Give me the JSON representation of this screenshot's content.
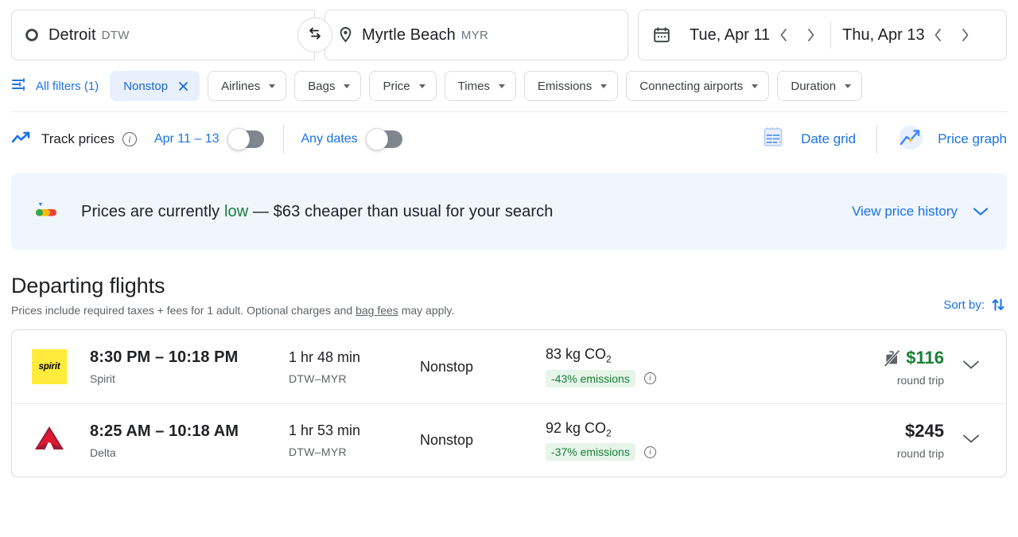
{
  "search": {
    "origin": {
      "city": "Detroit",
      "code": "DTW",
      "icon": "circle-outline-icon"
    },
    "destination": {
      "city": "Myrtle Beach",
      "code": "MYR",
      "icon": "location-pin-icon"
    },
    "swap_icon": "swap-arrows-icon",
    "calendar_icon": "calendar-icon",
    "depart_date": "Tue, Apr 11",
    "return_date": "Thu, Apr 13",
    "prev_label": "‹",
    "next_label": "›"
  },
  "filters": {
    "all_filters_label": "All filters (1)",
    "all_filters_icon": "tune-sliders-icon",
    "chips": [
      {
        "label": "Nonstop",
        "active": true,
        "close_icon": "close-icon"
      },
      {
        "label": "Airlines",
        "active": false
      },
      {
        "label": "Bags",
        "active": false
      },
      {
        "label": "Price",
        "active": false
      },
      {
        "label": "Times",
        "active": false
      },
      {
        "label": "Emissions",
        "active": false
      },
      {
        "label": "Connecting airports",
        "active": false
      },
      {
        "label": "Duration",
        "active": false
      }
    ]
  },
  "track_row": {
    "trend_icon": "trend-line-icon",
    "track_label": "Track prices",
    "info_icon": "info-icon",
    "toggles": [
      {
        "label": "Apr 11 – 13",
        "on": false
      },
      {
        "label": "Any dates",
        "on": false
      }
    ],
    "date_grid": {
      "label": "Date grid",
      "icon": "date-grid-icon"
    },
    "price_graph": {
      "label": "Price graph",
      "icon": "price-graph-icon"
    }
  },
  "banner": {
    "icon": "price-gauge-icon",
    "text_before": "Prices are currently ",
    "highlight": "low",
    "text_after": " — $63 cheaper than usual for your search",
    "link_label": "View price history",
    "chevron_icon": "chevron-down-icon",
    "bg_color": "#f0f5fe",
    "highlight_color": "#188038"
  },
  "departing": {
    "title": "Departing flights",
    "subtitle_before": "Prices include required taxes + fees for 1 adult. Optional charges and ",
    "subtitle_link": "bag fees",
    "subtitle_after": " may apply.",
    "sort_label": "Sort by:",
    "sort_icon": "sort-arrows-icon"
  },
  "flights": [
    {
      "airline_logo": "spirit-logo",
      "logo_text": "spirit",
      "times": "8:30 PM – 10:18 PM",
      "airline": "Spirit",
      "duration": "1 hr 48 min",
      "route": "DTW–MYR",
      "stops": "Nonstop",
      "emissions": "83 kg CO",
      "emissions_sub": "2",
      "emissions_badge": "-43% emissions",
      "emissions_info_icon": "info-icon",
      "bag_icon": "no-carry-on-bag-icon",
      "has_bag_icon": true,
      "price": "$116",
      "price_color": "green",
      "price_sub": "round trip",
      "expand_icon": "chevron-down-icon"
    },
    {
      "airline_logo": "delta-logo",
      "logo_text": "",
      "times": "8:25 AM – 10:18 AM",
      "airline": "Delta",
      "duration": "1 hr 53 min",
      "route": "DTW–MYR",
      "stops": "Nonstop",
      "emissions": "92 kg CO",
      "emissions_sub": "2",
      "emissions_badge": "-37% emissions",
      "emissions_info_icon": "info-icon",
      "bag_icon": "",
      "has_bag_icon": false,
      "price": "$245",
      "price_color": "black",
      "price_sub": "round trip",
      "expand_icon": "chevron-down-icon"
    }
  ],
  "colors": {
    "accent_blue": "#1a73e8",
    "chip_active_bg": "#e8f0fe",
    "green": "#188038",
    "spirit_yellow": "#ffeb3b",
    "delta_red": "#c8102e"
  }
}
